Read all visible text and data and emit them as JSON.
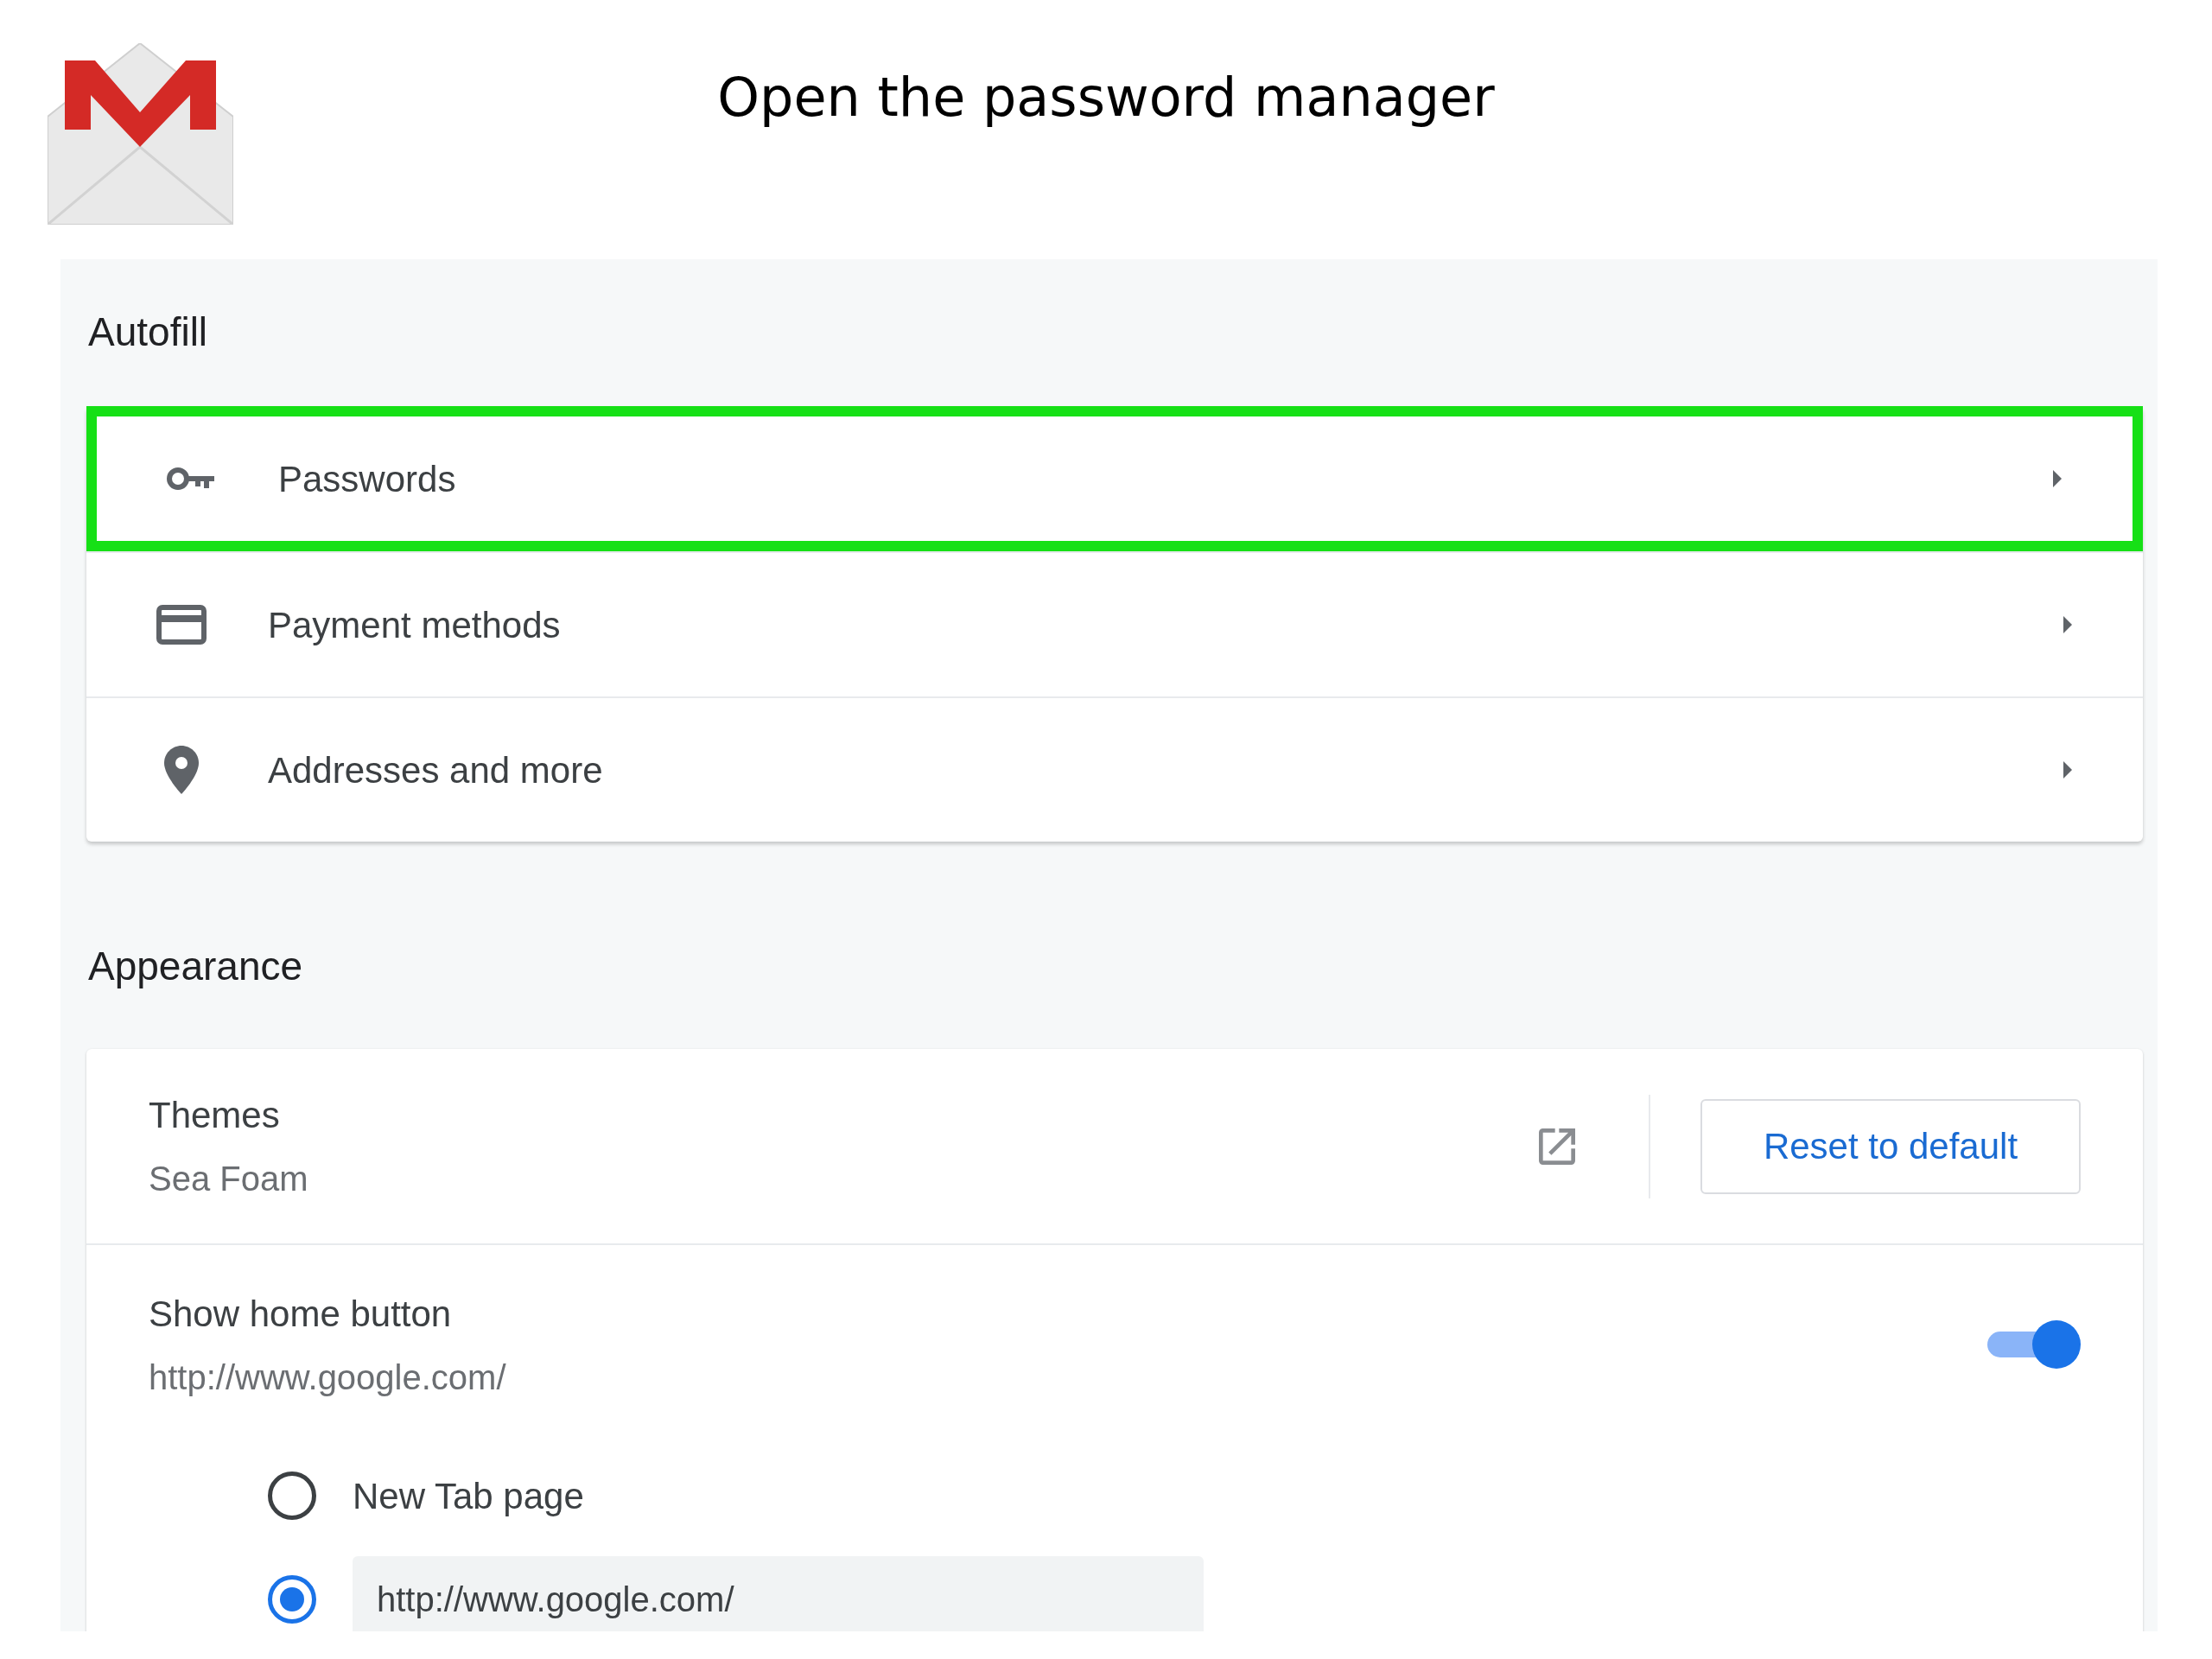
{
  "title": "Open the password manager",
  "autofill": {
    "heading": "Autofill",
    "items": [
      {
        "kind": "key",
        "label": "Passwords",
        "highlighted": true
      },
      {
        "kind": "card",
        "label": "Payment methods",
        "highlighted": false
      },
      {
        "kind": "pin",
        "label": "Addresses and more",
        "highlighted": false
      }
    ]
  },
  "appearance": {
    "heading": "Appearance",
    "themes": {
      "label": "Themes",
      "value": "Sea Foam",
      "button": "Reset to default"
    },
    "home_button": {
      "label": "Show home button",
      "value": "http://www.google.com/",
      "on": true,
      "options": [
        {
          "kind": "text",
          "label": "New Tab page",
          "selected": false
        },
        {
          "kind": "field",
          "value": "http://www.google.com/",
          "selected": true
        }
      ]
    }
  }
}
